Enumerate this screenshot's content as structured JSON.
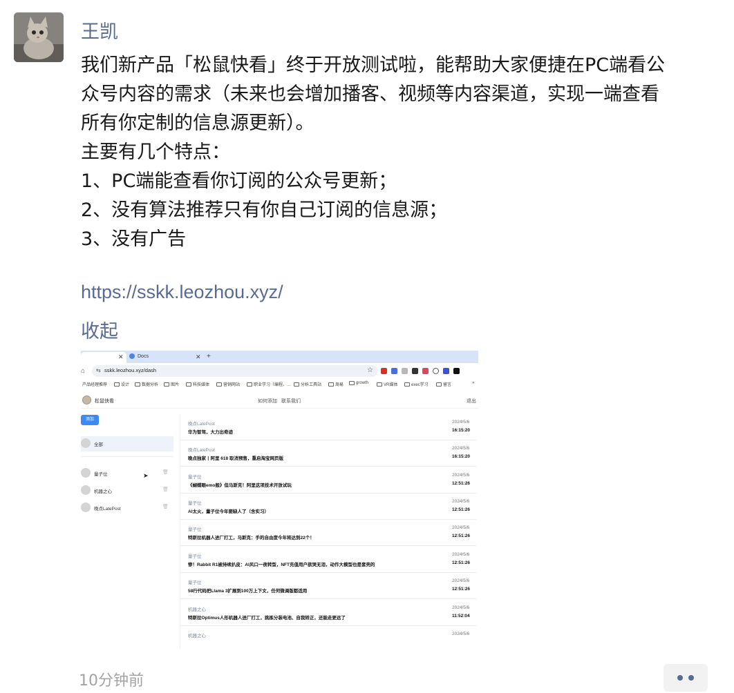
{
  "message": {
    "author": "王凯",
    "lines": [
      "我们新产品「松鼠快看」终于开放测试啦，能帮助大家便捷在PC端看公",
      "众号内容的需求（未来也会增加播客、视频等内容渠道，实现一端查看",
      "所有你定制的信息源更新）。",
      "主要有几个特点：",
      "1、PC端能查看你订阅的公众号更新；",
      "2、没有算法推荐只有你自己订阅的信息源；",
      "3、没有广告"
    ],
    "link": "https://sskk.leozhou.xyz/",
    "collapse_label": "收起",
    "timestamp": "10分钟前"
  },
  "screenshot": {
    "tabs": {
      "docs_label": "Docs"
    },
    "url": "sskk.leozhou.xyz/dash",
    "bookmarks": [
      "产品经理推荐",
      "设计",
      "数据分析",
      "图片",
      "科技媒体",
      "营销网站",
      "职业学习（编程、…",
      "分析工具站",
      "周易",
      "growth",
      "VR媒体",
      "exec学习",
      "留言"
    ],
    "app": {
      "name": "松鼠快看",
      "nav": [
        "如何添加",
        "联系我们"
      ],
      "logout": "退出",
      "add_button": "添加",
      "all_label": "全部",
      "sources": [
        "量子位",
        "机器之心",
        "晚点LatePost"
      ]
    },
    "feed": [
      {
        "source": "晚点LatePost",
        "title": "华为智驾，大力出奇迹",
        "date": "2024/5/6",
        "time": "16:15:20"
      },
      {
        "source": "晚点LatePost",
        "title": "晚点独家丨阿里 618 取消预售，重启淘宝网页版",
        "date": "2024/5/6",
        "time": "16:15:20"
      },
      {
        "source": "量子位",
        "title": "《蝴蝶眼emo般》但马斯克！阿里这项技术开放试玩",
        "date": "2024/5/6",
        "time": "12:51:26"
      },
      {
        "source": "量子位",
        "title": "AI太火，量子位今年要缺人了（含实习）",
        "date": "2024/5/6",
        "time": "12:51:26"
      },
      {
        "source": "量子位",
        "title": "特斯拉机器人进厂打工，马斯克：手的自由度今年将达到22个！",
        "date": "2024/5/6",
        "time": "12:51:26"
      },
      {
        "source": "量子位",
        "title": "惨！Rabbit R1被持续扒皮：AI风口一夜转型，NFT充值用户欲哭无泪，动作大模型也是套壳的",
        "date": "2024/5/6",
        "time": "12:51:26"
      },
      {
        "source": "量子位",
        "title": "58行代码把Llama 3扩展到100万上下文，任何微调版都适用",
        "date": "2024/5/6",
        "time": "12:51:26"
      },
      {
        "source": "机器之心",
        "title": "特斯拉Optimus人形机器人进厂打工，挑拣分装电池、自我矫正，还能走更远了",
        "date": "2024/5/6",
        "time": "11:52:04"
      },
      {
        "source": "机器之心",
        "title": "",
        "date": "2024/5/6",
        "time": ""
      }
    ]
  },
  "colors": {
    "link": "#576b95",
    "muted": "#a3a3a3",
    "accent": "#3d8af7"
  },
  "icons": [
    "home-icon",
    "tune-icon",
    "star-icon",
    "trash-icon",
    "cursor-icon",
    "more-icon"
  ]
}
